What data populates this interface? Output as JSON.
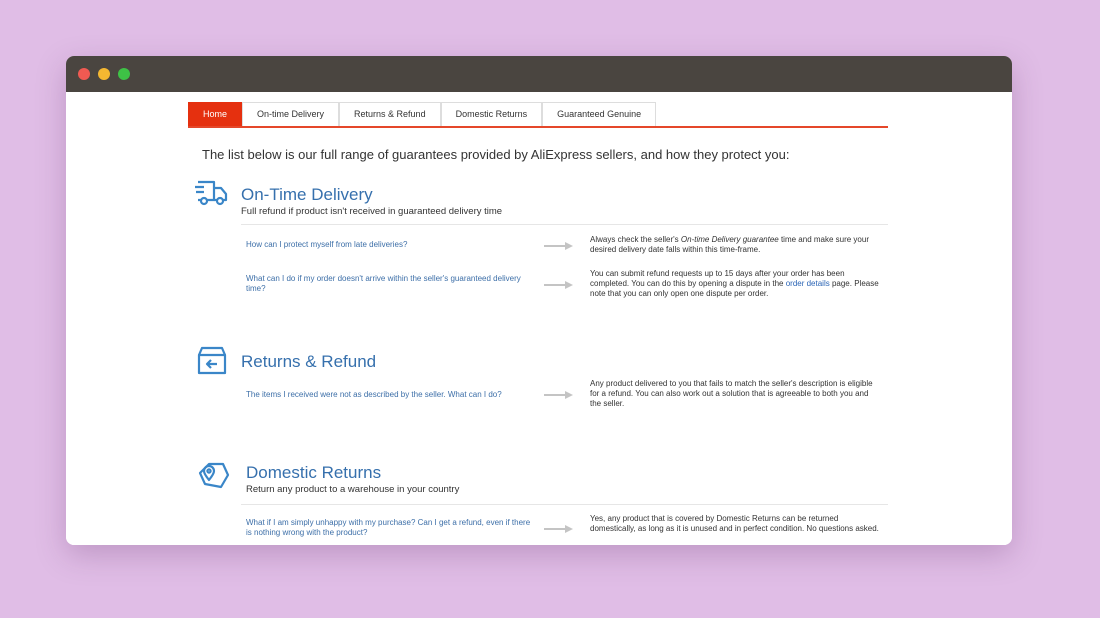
{
  "window": {
    "controls": [
      "close",
      "minimize",
      "maximize"
    ]
  },
  "tabs": [
    {
      "label": "Home",
      "active": true
    },
    {
      "label": "On-time Delivery",
      "active": false
    },
    {
      "label": "Returns & Refund",
      "active": false
    },
    {
      "label": "Domestic Returns",
      "active": false
    },
    {
      "label": "Guaranteed Genuine",
      "active": false
    }
  ],
  "intro": "The list below is our full range of guarantees provided by AliExpress sellers, and how they protect you:",
  "sections": {
    "ontime": {
      "icon": "delivery-truck-icon",
      "title": "On-Time Delivery",
      "subtitle": "Full refund if product isn't received in guaranteed delivery time",
      "faq": [
        {
          "q": "How can I protect myself from late deliveries?",
          "a_pre": "Always check the seller's ",
          "a_em": "On-time Delivery guarantee",
          "a_post": " time and make sure your desired delivery date falls within this time-frame."
        },
        {
          "q": "What can I do if my order doesn't arrive within the seller's guaranteed delivery time?",
          "a_pre": "You can submit refund requests up to 15 days after your order has been completed. You can do this by opening a dispute in the ",
          "a_link": "order details",
          "a_post": " page. Please note that you can only open one dispute per order."
        }
      ]
    },
    "returns": {
      "icon": "return-box-icon",
      "title": "Returns & Refund",
      "faq": [
        {
          "q": "The items I received were not as described by the seller. What can I do?",
          "a": "Any product delivered to you that fails to match the seller's description is eligible for a refund. You can also work out a solution that is agreeable to both you and the seller."
        }
      ]
    },
    "domestic": {
      "icon": "location-tag-icon",
      "title": "Domestic Returns",
      "subtitle": "Return any product to a warehouse in your country",
      "faq": [
        {
          "q": "What if I am simply unhappy with my purchase? Can I get a refund, even if there is nothing wrong with the product?",
          "a": "Yes, any product that is covered by Domestic Returns can be returned domestically, as long as it is unused and in perfect condition. No questions asked."
        }
      ]
    }
  },
  "colors": {
    "accent": "#e5300f",
    "link": "#3670ad",
    "background": "#e0bde6",
    "titlebar": "#4a4540"
  }
}
